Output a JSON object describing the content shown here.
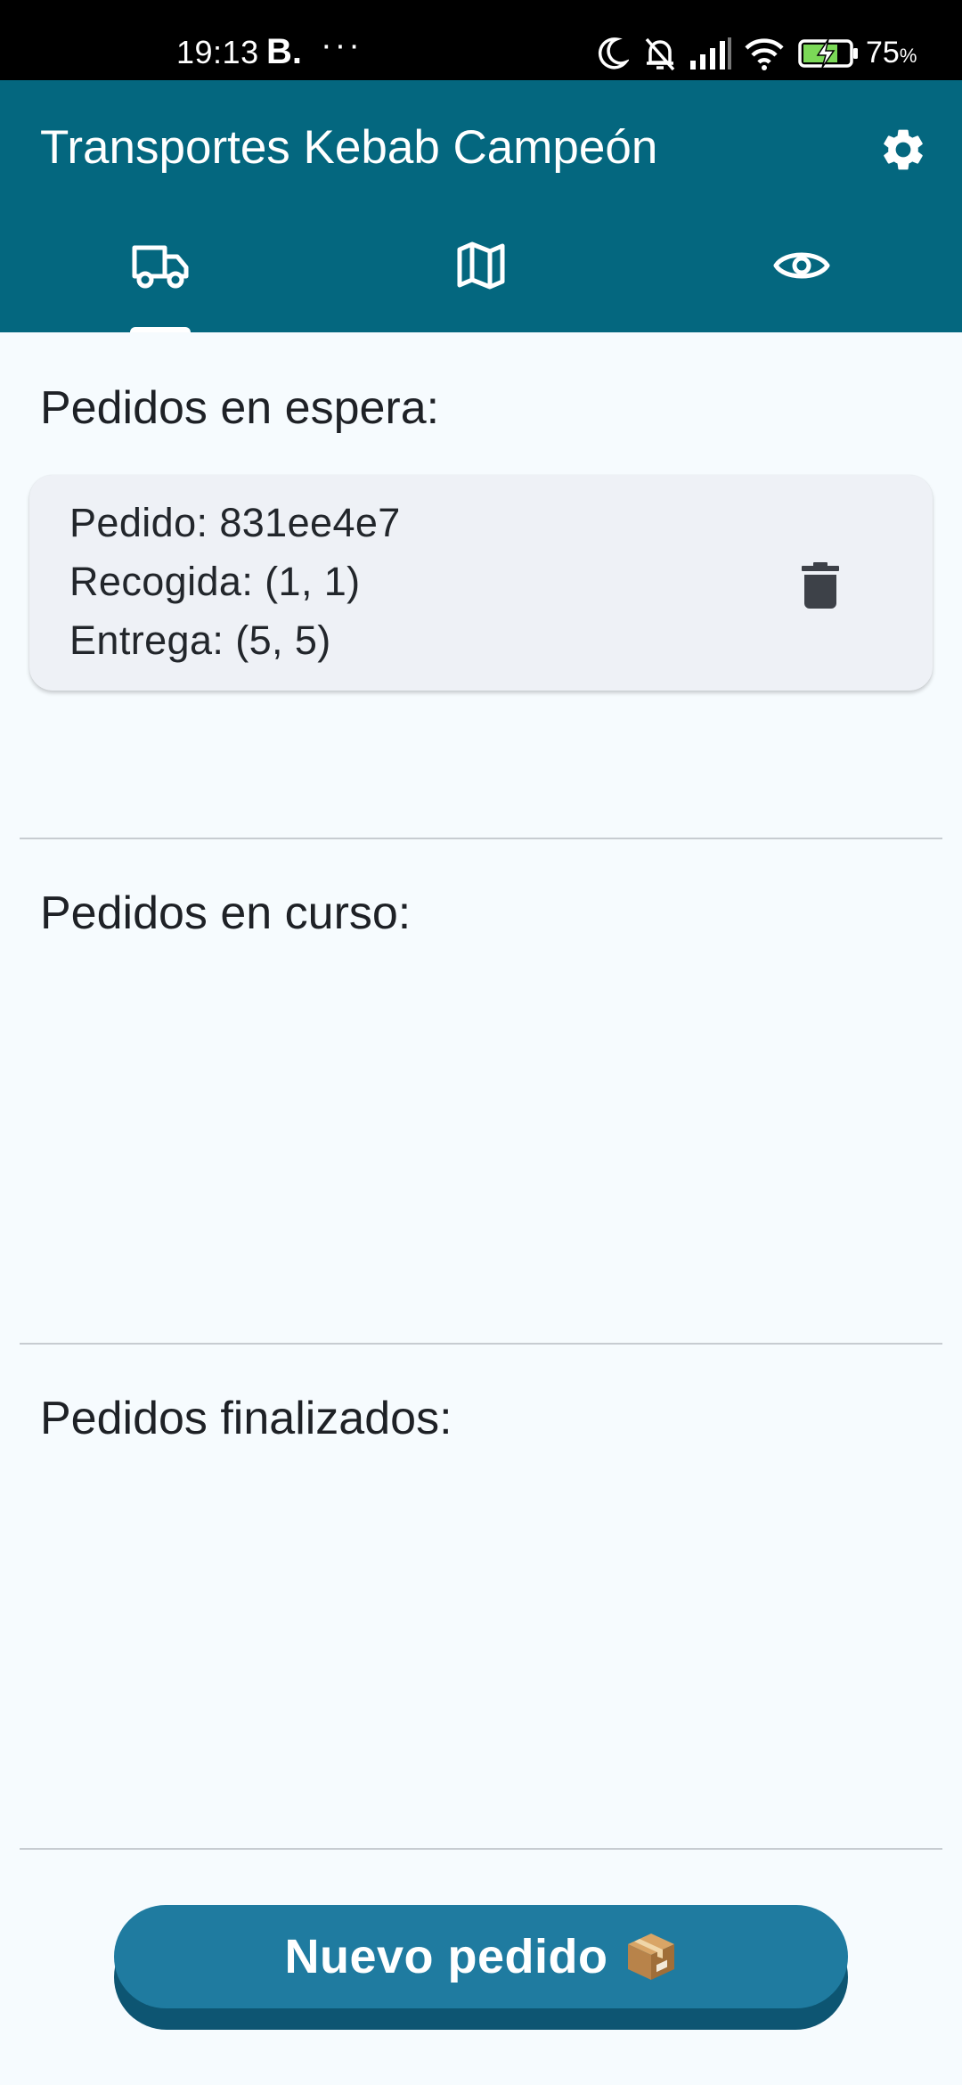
{
  "status_bar": {
    "time": "19:13",
    "notification_letter": "B.",
    "more_indicator": "···",
    "battery_percent": "75",
    "battery_unit": "%",
    "icons": [
      "moon-icon",
      "bell-off-icon",
      "signal-icon",
      "wifi-icon",
      "battery-charging-icon"
    ]
  },
  "app_bar": {
    "title": "Transportes Kebab Campeón",
    "settings_icon": "gear-icon",
    "tabs": [
      {
        "icon": "truck-icon",
        "selected": true
      },
      {
        "icon": "map-icon",
        "selected": false
      },
      {
        "icon": "eye-icon",
        "selected": false
      }
    ]
  },
  "colors": {
    "app_bar": "#04677f",
    "background": "#f6fbfe",
    "card": "#eef1f6",
    "button": "#1f7ba0",
    "button_shadow": "#0d5572"
  },
  "sections": {
    "waiting": {
      "title": "Pedidos en espera:",
      "orders": [
        {
          "id_line": "Pedido: 831ee4e7",
          "pickup_line": "Recogida: (1, 1)",
          "delivery_line": "Entrega: (5, 5)"
        }
      ]
    },
    "in_progress": {
      "title": "Pedidos en curso:",
      "orders": []
    },
    "finished": {
      "title": "Pedidos finalizados:",
      "orders": []
    }
  },
  "new_order_button": {
    "label": "Nuevo pedido",
    "icon": "package-icon"
  }
}
